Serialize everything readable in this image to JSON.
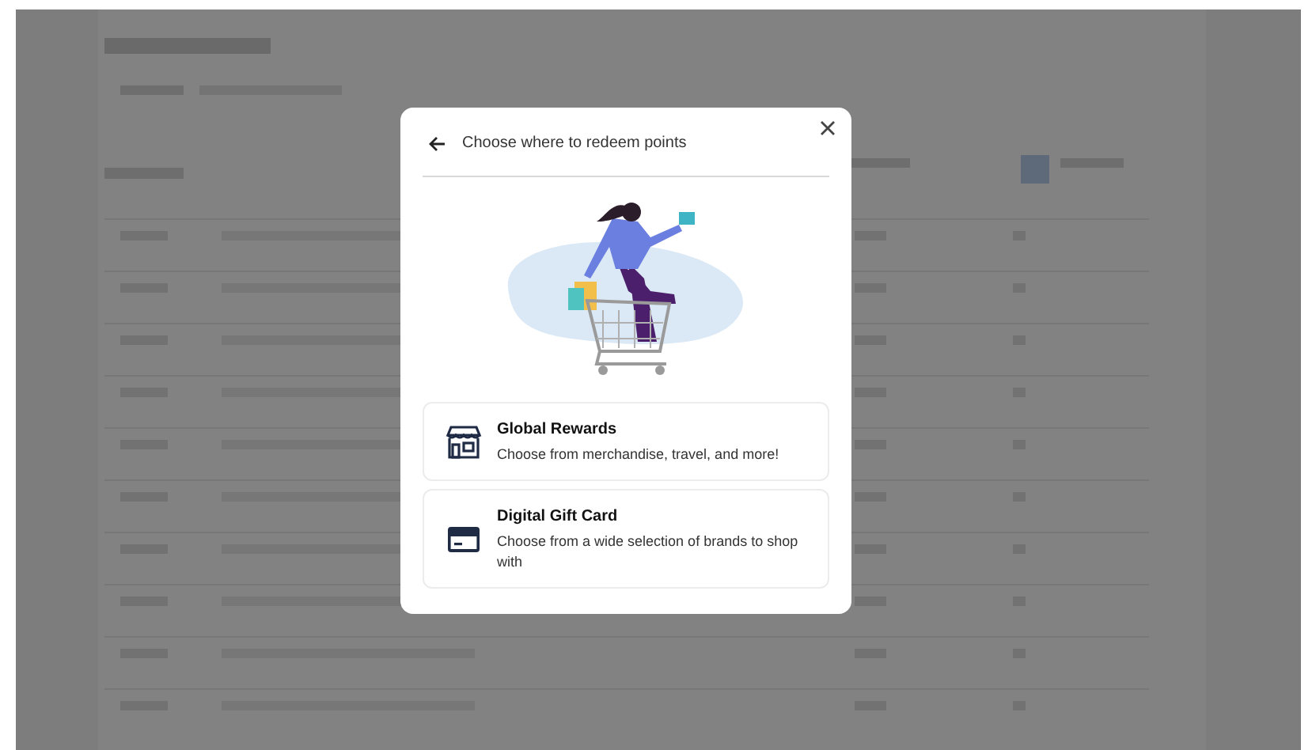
{
  "modal": {
    "title": "Choose where to redeem points",
    "options": [
      {
        "kind": "store",
        "title": "Global Rewards",
        "description": "Choose from merchandise, travel, and more!"
      },
      {
        "kind": "card",
        "title": "Digital Gift Card",
        "description": "Choose from a wide selection of brands to shop with"
      }
    ]
  }
}
